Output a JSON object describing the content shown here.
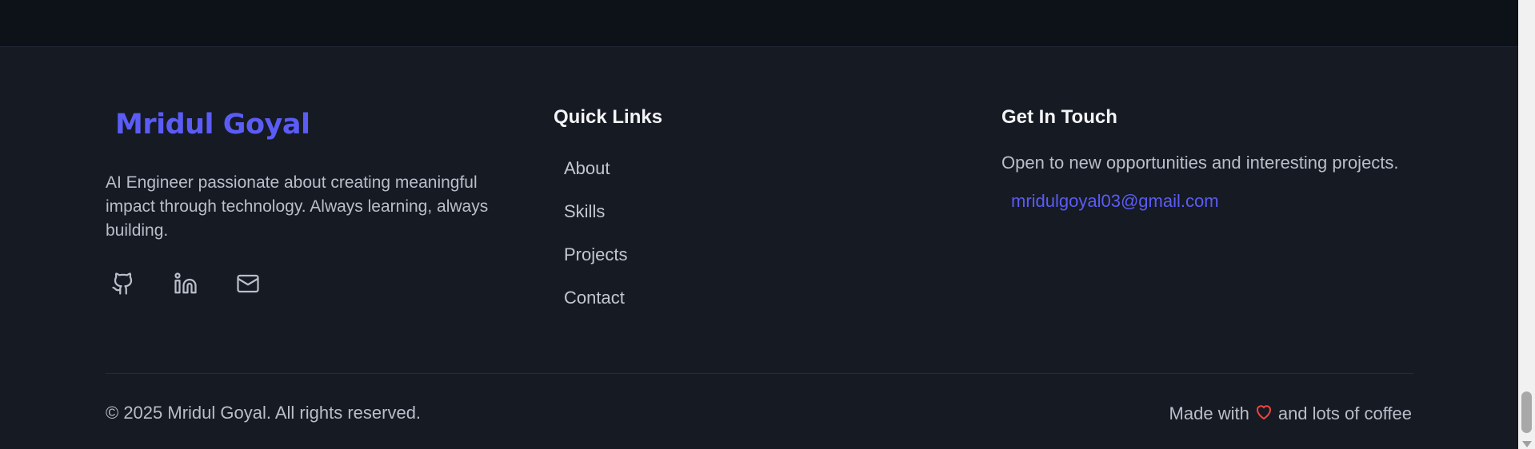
{
  "footer": {
    "brand": "Mridul Goyal",
    "bio": "AI Engineer passionate about creating meaningful impact through technology. Always learning, always building.",
    "socials": [
      {
        "icon": "github-icon"
      },
      {
        "icon": "linkedin-icon"
      },
      {
        "icon": "mail-icon"
      }
    ],
    "quick_links": {
      "title": "Quick Links",
      "items": [
        "About",
        "Skills",
        "Projects",
        "Contact"
      ]
    },
    "get_in_touch": {
      "title": "Get In Touch",
      "text": "Open to new opportunities and interesting projects.",
      "email": "mridulgoyal03@gmail.com"
    },
    "copyright": "© 2025 Mridul Goyal. All rights reserved.",
    "made_with_prefix": "Made with",
    "made_with_suffix": "and lots of coffee"
  },
  "colors": {
    "accent": "#5b5cf6",
    "background": "#161a23",
    "heart": "#ef4444"
  }
}
